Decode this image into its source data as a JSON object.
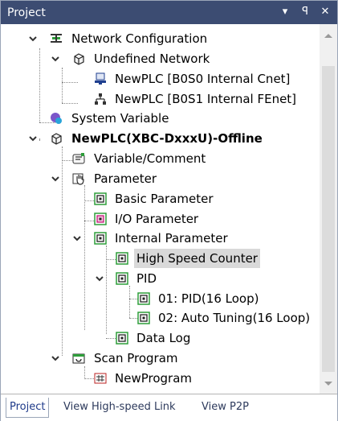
{
  "window": {
    "title": "Project",
    "buttons": [
      "▾",
      "ꟼ",
      "✕"
    ]
  },
  "tree": {
    "items": [
      {
        "label": "Network Configuration"
      },
      {
        "label": "Undefined Network"
      },
      {
        "label": "NewPLC [B0S0 Internal Cnet]"
      },
      {
        "label": "NewPLC [B0S1 Internal FEnet]"
      },
      {
        "label": "System Variable"
      },
      {
        "label": "NewPLC(XBC-DxxxU)-Offline"
      },
      {
        "label": "Variable/Comment"
      },
      {
        "label": "Parameter"
      },
      {
        "label": "Basic Parameter"
      },
      {
        "label": "I/O Parameter"
      },
      {
        "label": "Internal Parameter"
      },
      {
        "label": "High Speed Counter"
      },
      {
        "label": "PID"
      },
      {
        "label": "01: PID(16 Loop)"
      },
      {
        "label": "02: Auto Tuning(16 Loop)"
      },
      {
        "label": "Data Log"
      },
      {
        "label": "Scan Program"
      },
      {
        "label": "NewProgram"
      }
    ]
  },
  "tabs": [
    {
      "label": "Project"
    },
    {
      "label": "View High-speed Link"
    },
    {
      "label": "View P2P"
    }
  ],
  "colors": {
    "titlebar": "#3c4c72",
    "selection": "#d9d9d9",
    "icon_green": "#2e9e3a"
  }
}
